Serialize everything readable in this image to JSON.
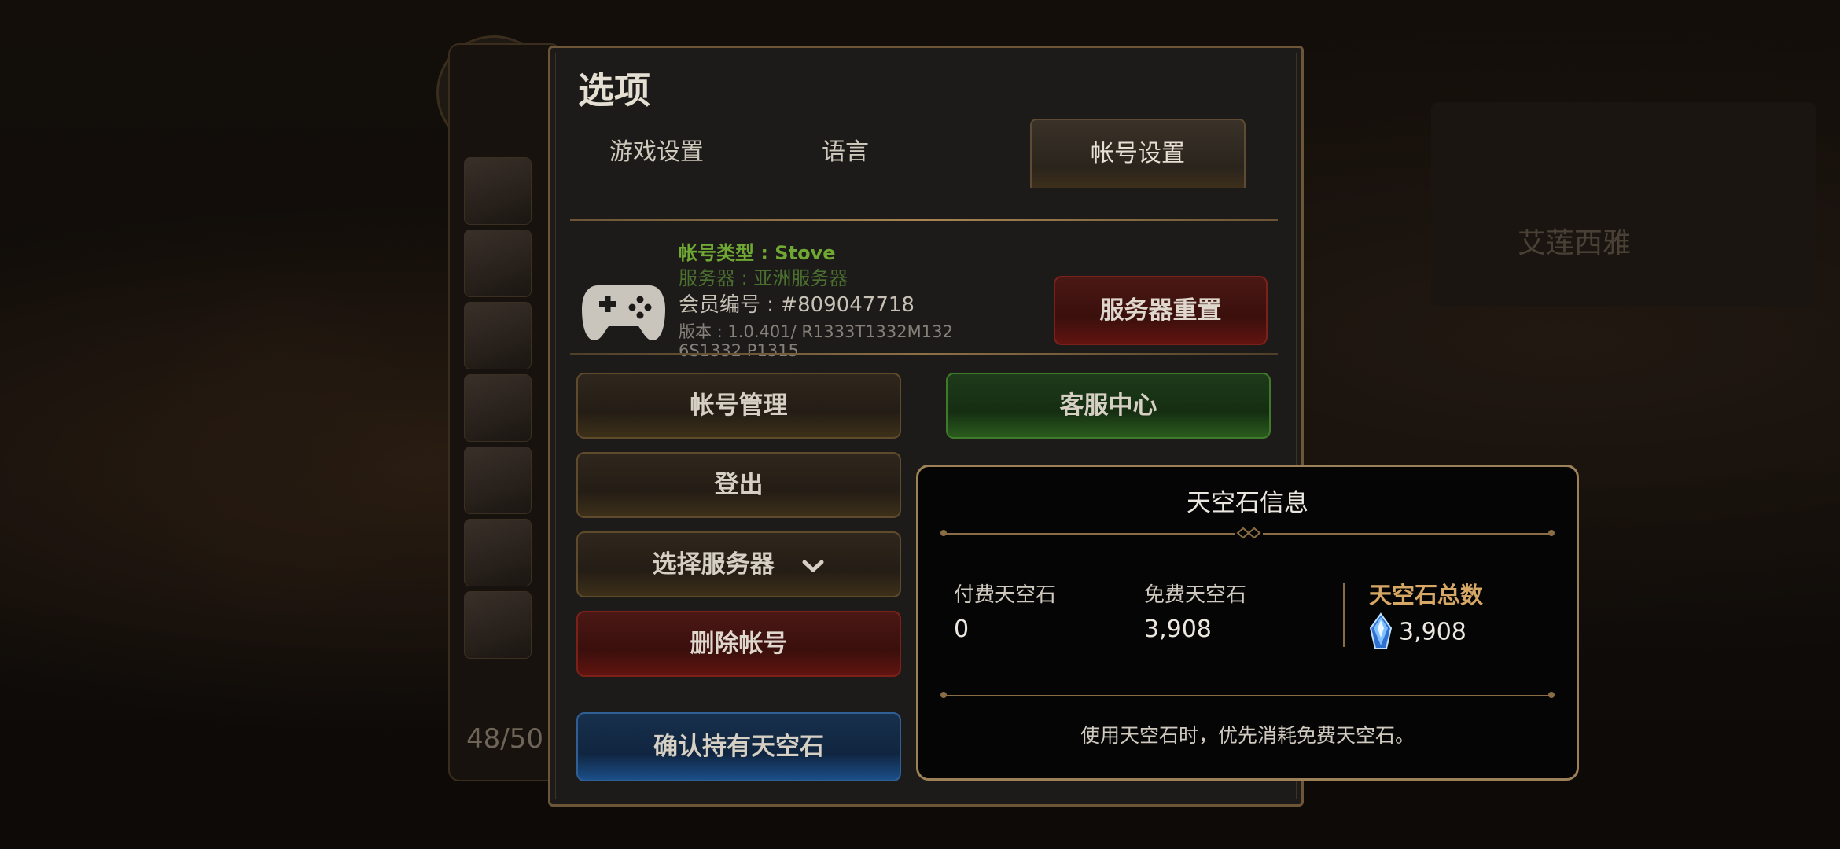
{
  "options": {
    "title": "选项",
    "tabs": [
      {
        "label": "游戏设置",
        "active": false
      },
      {
        "label": "语言",
        "active": false
      },
      {
        "label": "帐号设置",
        "active": true
      }
    ],
    "account": {
      "type": "帐号类型 : Stove",
      "server": "服务器 : 亚洲服务器",
      "member_no": "会员编号 : #809047718",
      "version": "版本 : 1.0.401/ R1333T1332M1326S1332 P1315",
      "icon": "gamepad-icon"
    },
    "buttons": {
      "server_reset": "服务器重置",
      "account_manage": "帐号管理",
      "customer_center": "客服中心",
      "logout": "登出",
      "select_server": "选择服务器",
      "delete_account": "删除帐号",
      "confirm_skystone": "确认持有天空石"
    }
  },
  "skystone_popup": {
    "title": "天空石信息",
    "paid_label": "付费天空石",
    "paid_value": "0",
    "free_label": "免费天空石",
    "free_value": "3,908",
    "total_label": "天空石总数",
    "total_value": "3,908",
    "note": "使用天空石时，优先消耗免费天空石。",
    "icon": "skystone-gem-icon"
  },
  "background": {
    "hero_count": "48/50",
    "banner_text": "艾莲西雅"
  },
  "colors": {
    "gold_border": "#9c8057",
    "account_type_green": "#6fa832",
    "total_label_gold": "#d6a765"
  }
}
